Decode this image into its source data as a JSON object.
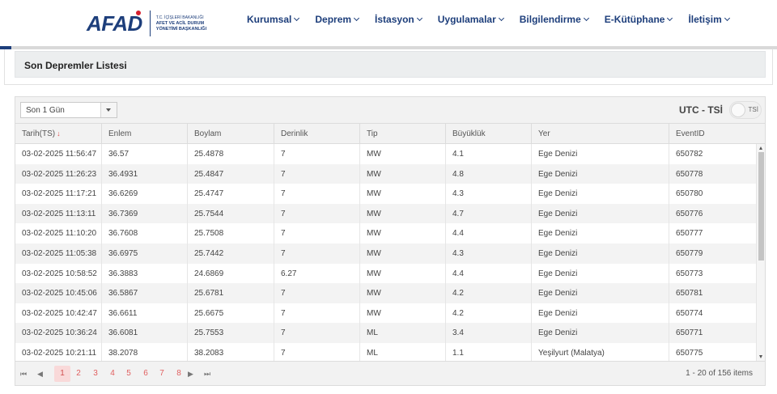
{
  "header": {
    "logo_word": "AFAD",
    "logo_line1": "T.C. İÇİŞLERİ BAKANLIĞI",
    "logo_line2": "AFET VE ACİL DURUM",
    "logo_line3": "YÖNETİMİ BAŞKANLIĞI",
    "nav": [
      "Kurumsal",
      "Deprem",
      "İstasyon",
      "Uygulamalar",
      "Bilgilendirme",
      "E-Kütüphane",
      "İletişim"
    ]
  },
  "page": {
    "title": "Son Depremler Listesi"
  },
  "toolbar": {
    "filter_value": "Son 1 Gün",
    "utc_label": "UTC - TSİ",
    "toggle_label": "TSİ"
  },
  "table": {
    "headers": [
      "Tarih(TS)",
      "Enlem",
      "Boylam",
      "Derinlik",
      "Tip",
      "Büyüklük",
      "Yer",
      "EventID"
    ],
    "sort_indicator": "↓",
    "rows": [
      [
        "03-02-2025 11:56:47",
        "36.57",
        "25.4878",
        "7",
        "MW",
        "4.1",
        "Ege Denizi",
        "650782"
      ],
      [
        "03-02-2025 11:26:23",
        "36.4931",
        "25.4847",
        "7",
        "MW",
        "4.8",
        "Ege Denizi",
        "650778"
      ],
      [
        "03-02-2025 11:17:21",
        "36.6269",
        "25.4747",
        "7",
        "MW",
        "4.3",
        "Ege Denizi",
        "650780"
      ],
      [
        "03-02-2025 11:13:11",
        "36.7369",
        "25.7544",
        "7",
        "MW",
        "4.7",
        "Ege Denizi",
        "650776"
      ],
      [
        "03-02-2025 11:10:20",
        "36.7608",
        "25.7508",
        "7",
        "MW",
        "4.4",
        "Ege Denizi",
        "650777"
      ],
      [
        "03-02-2025 11:05:38",
        "36.6975",
        "25.7442",
        "7",
        "MW",
        "4.3",
        "Ege Denizi",
        "650779"
      ],
      [
        "03-02-2025 10:58:52",
        "36.3883",
        "24.6869",
        "6.27",
        "MW",
        "4.4",
        "Ege Denizi",
        "650773"
      ],
      [
        "03-02-2025 10:45:06",
        "36.5867",
        "25.6781",
        "7",
        "MW",
        "4.2",
        "Ege Denizi",
        "650781"
      ],
      [
        "03-02-2025 10:42:47",
        "36.6611",
        "25.6675",
        "7",
        "MW",
        "4.2",
        "Ege Denizi",
        "650774"
      ],
      [
        "03-02-2025 10:36:24",
        "36.6081",
        "25.7553",
        "7",
        "ML",
        "3.4",
        "Ege Denizi",
        "650771"
      ],
      [
        "03-02-2025 10:21:11",
        "38.2078",
        "38.2083",
        "7",
        "ML",
        "1.1",
        "Yeşilyurt (Malatya)",
        "650775"
      ]
    ]
  },
  "pager": {
    "pages": [
      "1",
      "2",
      "3",
      "4",
      "5",
      "6",
      "7",
      "8"
    ],
    "active_page": "1",
    "first_icon": "⏮",
    "prev_icon": "◀",
    "next_icon": "▶",
    "last_icon": "⏭",
    "info": "1 - 20 of 156 items"
  },
  "colors": {
    "brand": "#1d3e7b",
    "accent_red": "#d6202f",
    "pager_link": "#e06060"
  }
}
